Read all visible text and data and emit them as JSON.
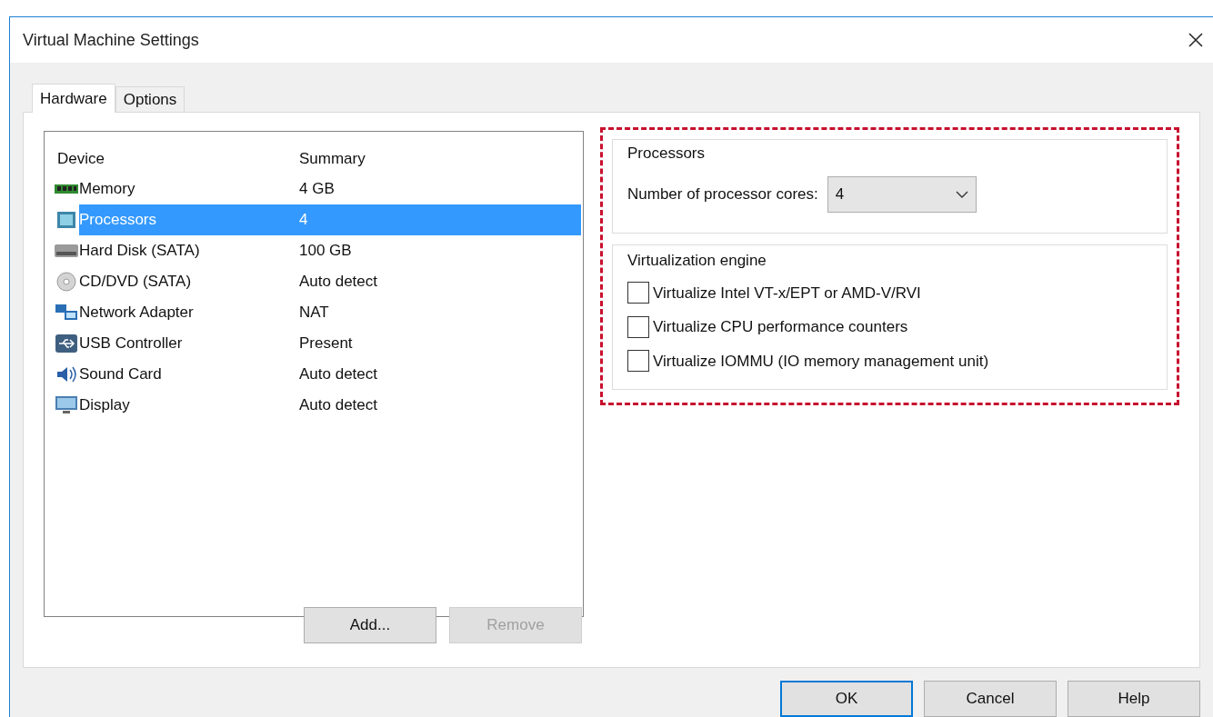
{
  "window": {
    "title": "Virtual Machine Settings"
  },
  "tabs": [
    {
      "label": "Hardware",
      "selected": true
    },
    {
      "label": "Options",
      "selected": false
    }
  ],
  "device_list": {
    "columns": [
      "Device",
      "Summary"
    ],
    "rows": [
      {
        "kind": "memory",
        "device": "Memory",
        "summary": "4 GB",
        "selected": false
      },
      {
        "kind": "processor",
        "device": "Processors",
        "summary": "4",
        "selected": true
      },
      {
        "kind": "disk",
        "device": "Hard Disk (SATA)",
        "summary": "100 GB",
        "selected": false
      },
      {
        "kind": "cdrom",
        "device": "CD/DVD (SATA)",
        "summary": "Auto detect",
        "selected": false
      },
      {
        "kind": "network",
        "device": "Network Adapter",
        "summary": "NAT",
        "selected": false
      },
      {
        "kind": "usb",
        "device": "USB Controller",
        "summary": "Present",
        "selected": false
      },
      {
        "kind": "sound",
        "device": "Sound Card",
        "summary": "Auto detect",
        "selected": false
      },
      {
        "kind": "display",
        "device": "Display",
        "summary": "Auto detect",
        "selected": false
      }
    ]
  },
  "list_buttons": [
    {
      "label": "Add...",
      "disabled": false
    },
    {
      "label": "Remove",
      "disabled": true
    }
  ],
  "processors_group": {
    "title": "Processors",
    "label": "Number of processor cores:",
    "value": "4"
  },
  "virtualization_group": {
    "title": "Virtualization engine",
    "options": [
      {
        "label": "Virtualize Intel VT-x/EPT or AMD-V/RVI",
        "checked": false
      },
      {
        "label": "Virtualize CPU performance counters",
        "checked": false
      },
      {
        "label": "Virtualize IOMMU (IO memory management unit)",
        "checked": false
      }
    ]
  },
  "dialog_buttons": [
    {
      "label": "OK",
      "default": true
    },
    {
      "label": "Cancel",
      "default": false
    },
    {
      "label": "Help",
      "default": false
    }
  ]
}
